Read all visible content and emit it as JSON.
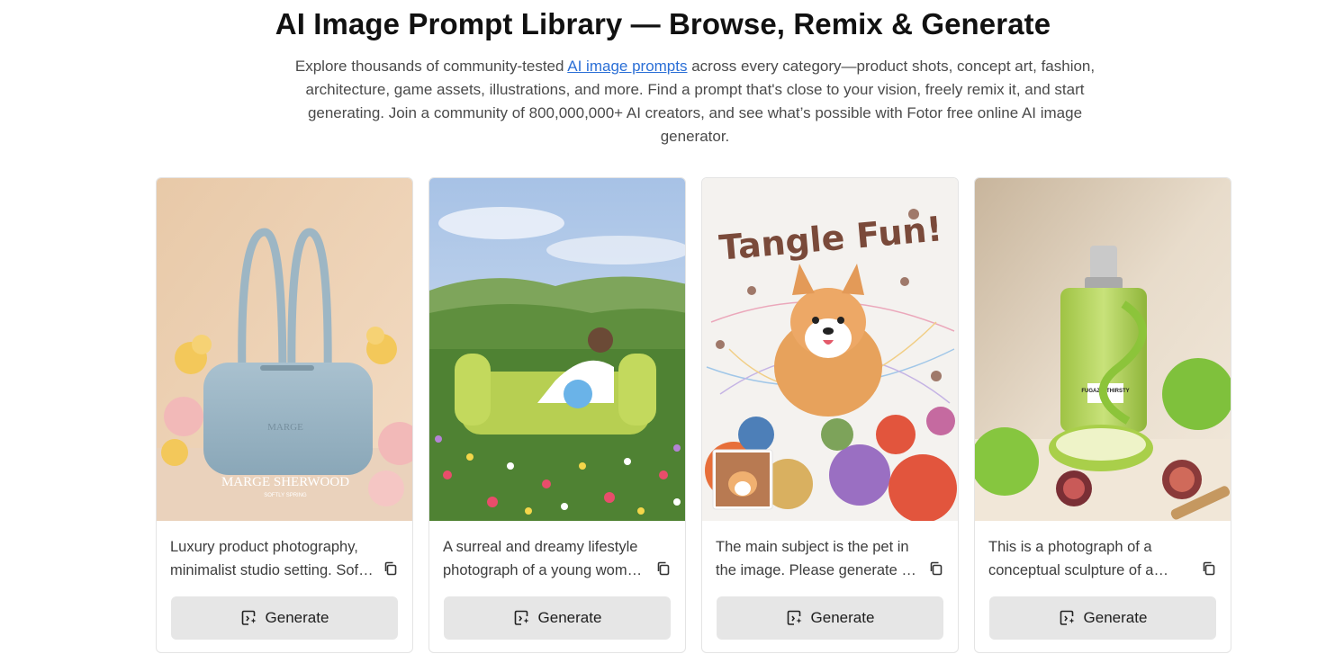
{
  "header": {
    "title": "AI Image Prompt Library — Browse, Remix & Generate",
    "intro_before_link": "Explore thousands of community-tested ",
    "intro_link": "AI image prompts",
    "intro_after_link": " across every category—product shots, concept art, fashion, architecture, game assets, illustrations, and more. Find a prompt that's close to your vision, freely remix it, and start generating. Join a community of 800,000,000+ AI creators, and see what’s possible with Fotor free online AI image generator."
  },
  "cards": [
    {
      "image_label": "MARGE SHERWOOD",
      "image_sublabel": "SOFTLY SPRING",
      "description": "Luxury product photography, minimalist studio setting. Soft pastel spring scene with a pale blue handbag.",
      "generate_label": "Generate"
    },
    {
      "description": "A surreal and dreamy lifestyle photograph of a young woman relaxing on a green sofa in a wildflower meadow.",
      "generate_label": "Generate"
    },
    {
      "image_label": "Tangle Fun!",
      "description": "The main subject is the pet in the image. Please generate a playful illustrated scene with yarn balls.",
      "generate_label": "Generate"
    },
    {
      "image_label": "FUGAZZI THIRSTY",
      "description": "This is a photograph of a conceptual sculpture of a perfume bottle with green apples and figs.",
      "generate_label": "Generate"
    }
  ],
  "colors": {
    "link": "#2b6fd6",
    "button_bg": "#e6e6e6",
    "card_border": "#e4e4e4"
  },
  "icons": {
    "copy": "copy-icon",
    "generate": "generate-icon"
  }
}
